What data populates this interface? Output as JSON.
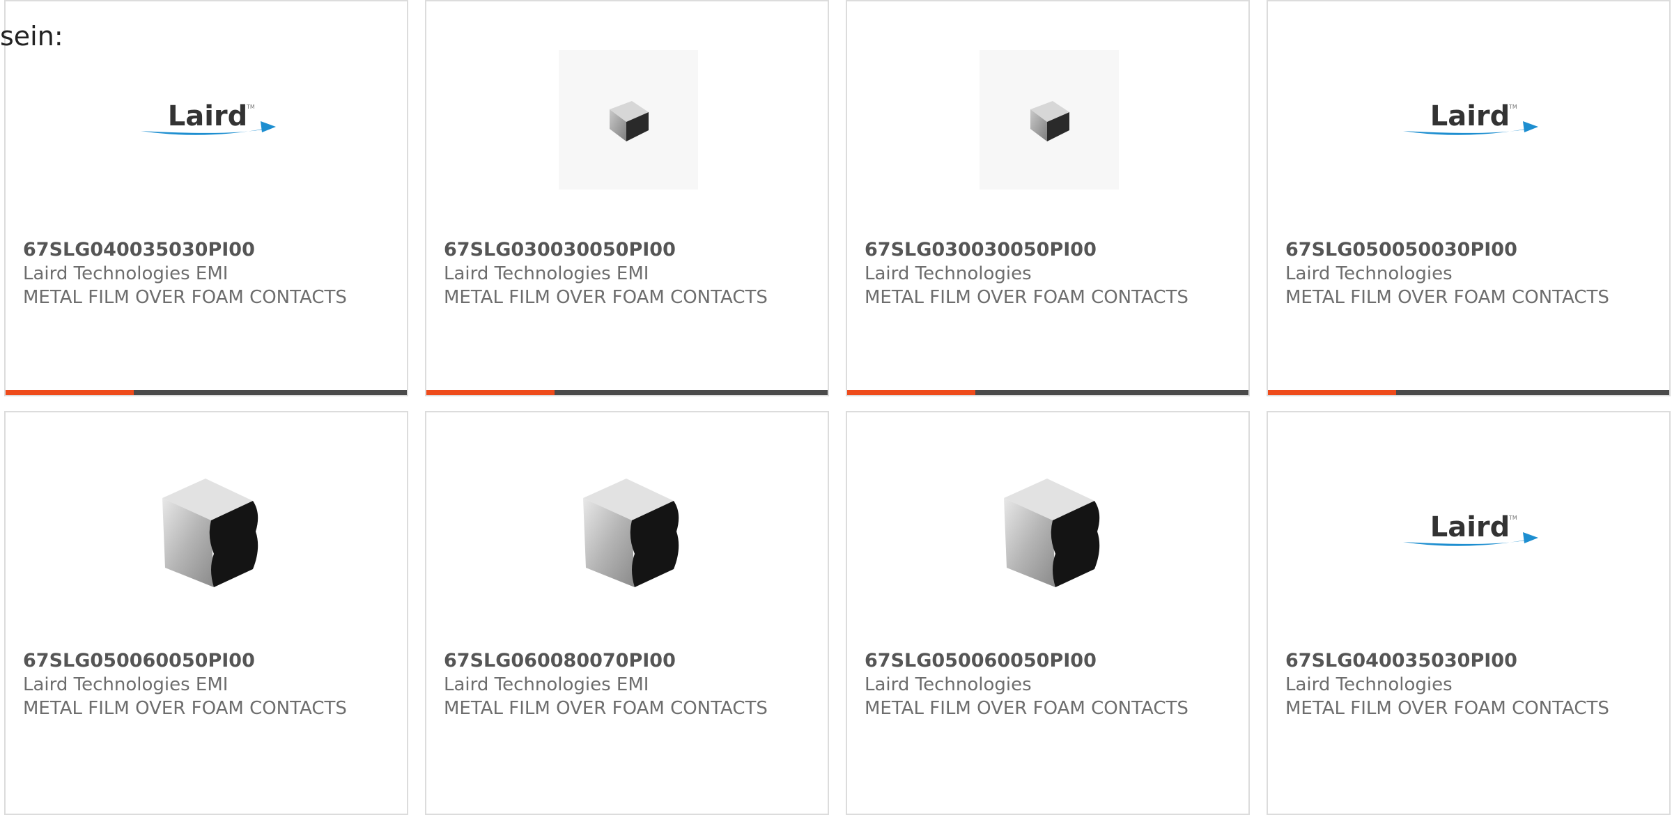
{
  "intro_text": "sein:",
  "accent_color": "#ee4b1b",
  "bar_color": "#4a4a4a",
  "products": [
    {
      "part_number": "67SLG040035030PI00",
      "manufacturer": "Laird Technologies EMI",
      "description": "METAL FILM OVER FOAM CONTACTS",
      "image": "laird-logo",
      "bar_progress": 0.32
    },
    {
      "part_number": "67SLG030030050PI00",
      "manufacturer": "Laird Technologies EMI",
      "description": "METAL FILM OVER FOAM CONTACTS",
      "image": "foam-contact-small",
      "bar_progress": 0.32
    },
    {
      "part_number": "67SLG030030050PI00",
      "manufacturer": "Laird Technologies",
      "description": "METAL FILM OVER FOAM CONTACTS",
      "image": "foam-contact-small",
      "bar_progress": 0.32
    },
    {
      "part_number": "67SLG050050030PI00",
      "manufacturer": "Laird Technologies",
      "description": "METAL FILM OVER FOAM CONTACTS",
      "image": "laird-logo",
      "bar_progress": 0.32
    },
    {
      "part_number": "67SLG050060050PI00",
      "manufacturer": "Laird Technologies EMI",
      "description": "METAL FILM OVER FOAM CONTACTS",
      "image": "foam-contact-large"
    },
    {
      "part_number": "67SLG060080070PI00",
      "manufacturer": "Laird Technologies EMI",
      "description": "METAL FILM OVER FOAM CONTACTS",
      "image": "foam-contact-large"
    },
    {
      "part_number": "67SLG050060050PI00",
      "manufacturer": "Laird Technologies",
      "description": "METAL FILM OVER FOAM CONTACTS",
      "image": "foam-contact-large"
    },
    {
      "part_number": "67SLG040035030PI00",
      "manufacturer": "Laird Technologies",
      "description": "METAL FILM OVER FOAM CONTACTS",
      "image": "laird-logo"
    }
  ]
}
